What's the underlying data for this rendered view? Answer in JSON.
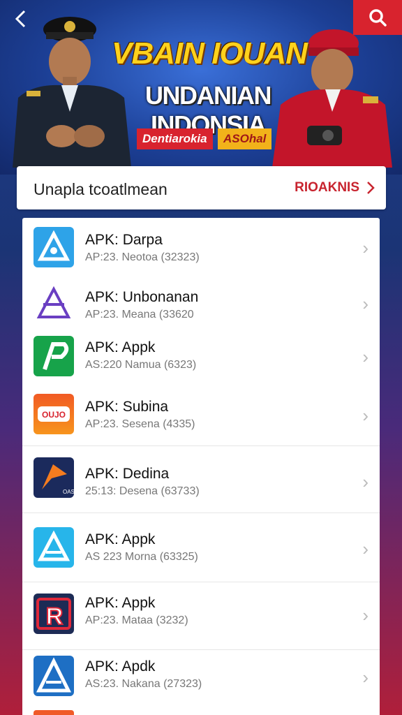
{
  "banner": {
    "title_line1": "VBAIN IOUAN",
    "title_line2": "UNDANIAN INDONSIA",
    "badge_left": "Dentiarokia",
    "badge_right": "ASOhal"
  },
  "section": {
    "title": "Unapla tcoatlmean",
    "see_all": "RIOAKNIS"
  },
  "apps": [
    {
      "name": "APK: Darpa",
      "meta": "AP:23.  Neotoa (32323)",
      "icon": "triangle-blue-icon"
    },
    {
      "name": "APK: Unbonanan",
      "meta": "AP:23.  Meana (33620",
      "icon": "triangle-outline-purple-icon"
    },
    {
      "name": "APK: Appk",
      "meta": "AS:220  Namua (6323)",
      "icon": "p-green-icon"
    },
    {
      "name": "APK: Subina",
      "meta": "AP:23.  Sesena (4335)",
      "icon": "orange-badge-icon"
    },
    {
      "name": "APK: Dedina",
      "meta": "25:13:  Desena (63733)",
      "icon": "arrow-orange-navy-icon"
    },
    {
      "name": "APK: Appk",
      "meta": "AS 223  Morna (63325)",
      "icon": "triangle-cyan-icon"
    },
    {
      "name": "APK: Appk",
      "meta": "AP:23.  Mataa (3232)",
      "icon": "r-red-icon"
    },
    {
      "name": "APK: Apdk",
      "meta": "AS:23.  Nakana (27323)",
      "icon": "a-blue-icon"
    }
  ],
  "colors": {
    "accent": "#d8232e",
    "title_yellow": "#ffd21c",
    "banner_blue": "#1c3f95"
  }
}
